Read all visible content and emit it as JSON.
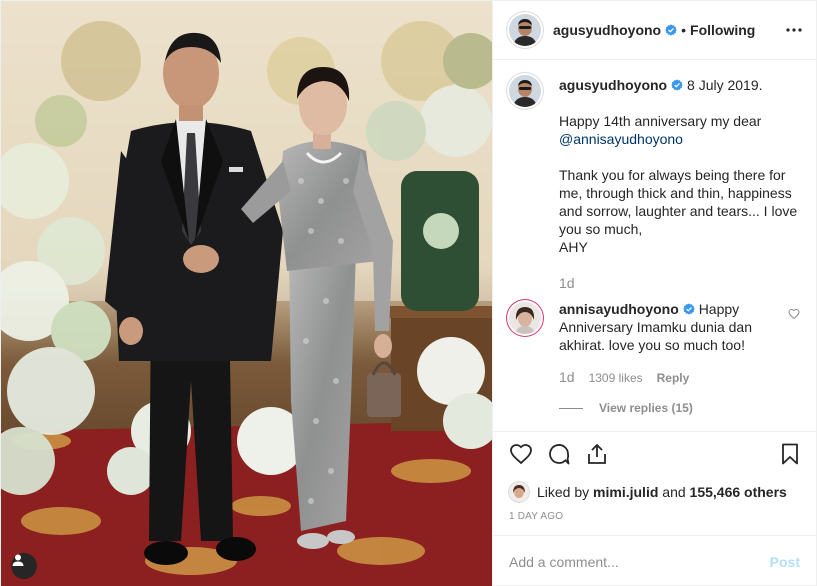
{
  "post": {
    "author": "agusyudhoyono",
    "follow_state": "Following",
    "dot": "•",
    "verified_color": "#3897f0",
    "photo_alt": "Couple standing at a floral-decorated event"
  },
  "caption": {
    "author": "agusyudhoyono",
    "date": "8 July 2019.",
    "line1": "Happy 14th anniversary my dear",
    "mention": "@annisayudhoyono",
    "paragraph2": "Thank you for always being there for me, through thick and thin, happiness and sorrow, laughter and tears... I love you so much,",
    "signoff": "AHY",
    "age": "1d"
  },
  "reply": {
    "author": "annisayudhoyono",
    "text": "Happy Anniversary Imamku dunia dan akhirat. love you so much too!",
    "age": "1d",
    "likes": "1309 likes",
    "reply_label": "Reply",
    "view_replies": "View replies (15)"
  },
  "likes": {
    "prefix": "Liked by",
    "user": "mimi.julid",
    "and": "and",
    "others": "155,466 others"
  },
  "timestamp": "1 DAY AGO",
  "comment_box": {
    "placeholder": "Add a comment...",
    "post_label": "Post"
  },
  "icons": {
    "like": "heart-icon",
    "comment": "comment-icon",
    "share": "share-icon",
    "save": "bookmark-icon",
    "more": "more-options-icon",
    "tag": "user-tag-icon"
  }
}
